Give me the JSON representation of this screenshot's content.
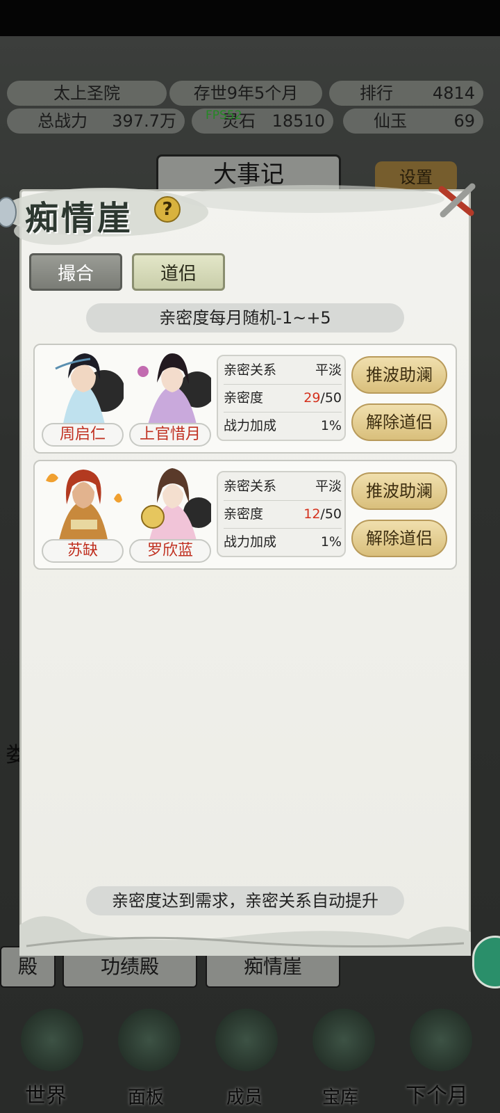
{
  "background": {
    "sect_name": "太上圣院",
    "age": "存世9年5个月",
    "rank_label": "排行",
    "rank_value": "4814",
    "power_label": "总战力",
    "power_value": "397.7万",
    "spirit_stone_label": "灵石",
    "spirit_stone_value": "18510",
    "jade_label": "仙玉",
    "jade_value": "69",
    "fps": "FPS52",
    "events_title": "大事记",
    "settings_label": "设置",
    "sub_nav": [
      "殿",
      "功绩殿",
      "痴情崖"
    ],
    "side_char": "娄",
    "nav": [
      "世界",
      "面板",
      "成员",
      "宝库",
      "下个月"
    ]
  },
  "modal": {
    "title": "痴情崖",
    "help": "?",
    "tabs": [
      "撮合",
      "道侣"
    ],
    "active_tab": "道侣",
    "info_banner": "亲密度每月随机-1~+5",
    "footer_banner": "亲密度达到需求，亲密关系自动提升",
    "labels": {
      "relation": "亲密关系",
      "intimacy": "亲密度",
      "bonus": "战力加成"
    },
    "couples": [
      {
        "male": "周启仁",
        "female": "上官惜月",
        "relation": "平淡",
        "intimacy_current": "29",
        "intimacy_max": "/50",
        "bonus": "1%",
        "btn_boost": "推波助澜",
        "btn_dissolve": "解除道侣"
      },
      {
        "male": "苏缺",
        "female": "罗欣蓝",
        "relation": "平淡",
        "intimacy_current": "12",
        "intimacy_max": "/50",
        "bonus": "1%",
        "btn_boost": "推波助澜",
        "btn_dissolve": "解除道侣"
      }
    ]
  },
  "colors": {
    "accent_red": "#d4301c",
    "gold_button": "#d9bf7c"
  }
}
